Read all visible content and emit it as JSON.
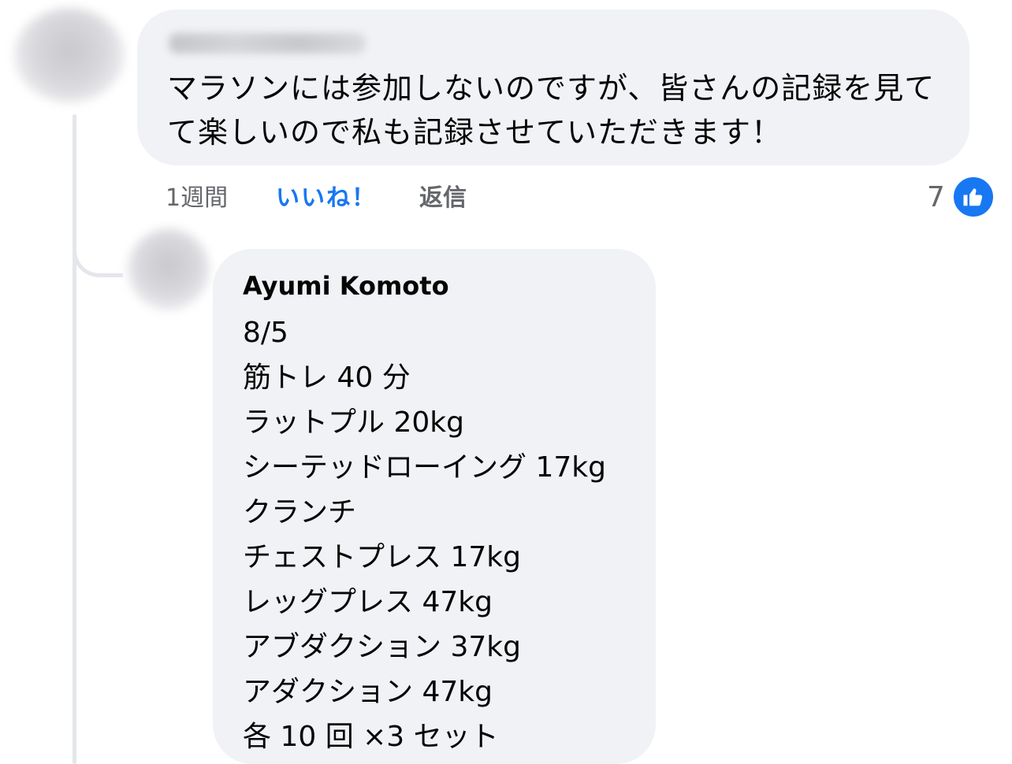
{
  "comment": {
    "text": "マラソンには参加しないのですが、皆さんの記録を見て\nて楽しいので私も記録させていただきます！",
    "actions": {
      "time": "1週間",
      "like": "いいね！",
      "reply": "返信"
    },
    "reaction_count": "7",
    "reaction_icon": "thumbs-up-icon",
    "accent_color": "#1877f2"
  },
  "reply": {
    "author": "Ayumi Komoto",
    "lines": [
      "8/5",
      "筋トレ 40 分",
      "ラットプル 20kg",
      "シーテッドローイング 17kg",
      "クランチ",
      "チェストプレス 17kg",
      "レッグプレス 47kg",
      "アブダクション 37kg",
      "アダクション 47kg",
      "各 10 回 ×3 セット"
    ]
  }
}
